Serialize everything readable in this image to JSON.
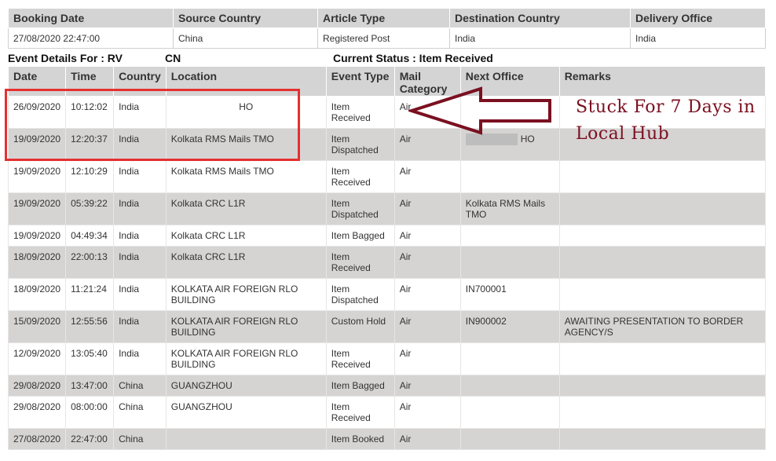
{
  "booking": {
    "headers": [
      "Booking Date",
      "Source Country",
      "Article Type",
      "Destination Country",
      "Delivery Office"
    ],
    "values": [
      "27/08/2020 22:47:00",
      "China",
      "Registered Post",
      "India",
      "India"
    ]
  },
  "event_header": {
    "details_prefix": "Event Details For : RV",
    "details_suffix": "CN",
    "status": "Current Status : Item Received"
  },
  "events": {
    "headers": [
      "Date",
      "Time",
      "Country",
      "Location",
      "Event Type",
      "Mail Category",
      "Next Office",
      "Remarks"
    ],
    "rows": [
      {
        "date": "26/09/2020",
        "time": "10:12:02",
        "country": "India",
        "location": "HO",
        "event": "Item Received",
        "category": "Air",
        "next_office": "",
        "remarks": ""
      },
      {
        "date": "19/09/2020",
        "time": "12:20:37",
        "country": "India",
        "location": "Kolkata RMS Mails TMO",
        "event": "Item Dispatched",
        "category": "Air",
        "next_office": "HO",
        "remarks": ""
      },
      {
        "date": "19/09/2020",
        "time": "12:10:29",
        "country": "India",
        "location": "Kolkata RMS Mails TMO",
        "event": "Item Received",
        "category": "Air",
        "next_office": "",
        "remarks": ""
      },
      {
        "date": "19/09/2020",
        "time": "05:39:22",
        "country": "India",
        "location": "Kolkata CRC L1R",
        "event": "Item Dispatched",
        "category": "Air",
        "next_office": "Kolkata RMS Mails TMO",
        "remarks": ""
      },
      {
        "date": "19/09/2020",
        "time": "04:49:34",
        "country": "India",
        "location": "Kolkata CRC L1R",
        "event": "Item Bagged",
        "category": "Air",
        "next_office": "",
        "remarks": ""
      },
      {
        "date": "18/09/2020",
        "time": "22:00:13",
        "country": "India",
        "location": "Kolkata CRC L1R",
        "event": "Item Received",
        "category": "Air",
        "next_office": "",
        "remarks": ""
      },
      {
        "date": "18/09/2020",
        "time": "11:21:24",
        "country": "India",
        "location": "KOLKATA AIR FOREIGN RLO BUILDING",
        "event": "Item Dispatched",
        "category": "Air",
        "next_office": "IN700001",
        "remarks": ""
      },
      {
        "date": "15/09/2020",
        "time": "12:55:56",
        "country": "India",
        "location": "KOLKATA AIR FOREIGN RLO BUILDING",
        "event": "Custom Hold",
        "category": "Air",
        "next_office": "IN900002",
        "remarks": "AWAITING PRESENTATION TO BORDER AGENCY/S"
      },
      {
        "date": "12/09/2020",
        "time": "13:05:40",
        "country": "India",
        "location": "KOLKATA AIR FOREIGN RLO BUILDING",
        "event": "Item Received",
        "category": "Air",
        "next_office": "",
        "remarks": ""
      },
      {
        "date": "29/08/2020",
        "time": "13:47:00",
        "country": "China",
        "location": "GUANGZHOU",
        "event": "Item Bagged",
        "category": "Air",
        "next_office": "",
        "remarks": ""
      },
      {
        "date": "29/08/2020",
        "time": "08:00:00",
        "country": "China",
        "location": "GUANGZHOU",
        "event": "Item Received",
        "category": "Air",
        "next_office": "",
        "remarks": ""
      },
      {
        "date": "27/08/2020",
        "time": "22:47:00",
        "country": "China",
        "location": "",
        "event": "Item Booked",
        "category": "Air",
        "next_office": "",
        "remarks": ""
      }
    ]
  },
  "annotation": {
    "line1": "Stuck For 7 Days in",
    "line2": "Local Hub",
    "color": "#7a1020"
  },
  "colors": {
    "header_bg": "#d4d4d4",
    "row_alt_bg": "#d6d3d3",
    "highlight": "#e53030"
  }
}
